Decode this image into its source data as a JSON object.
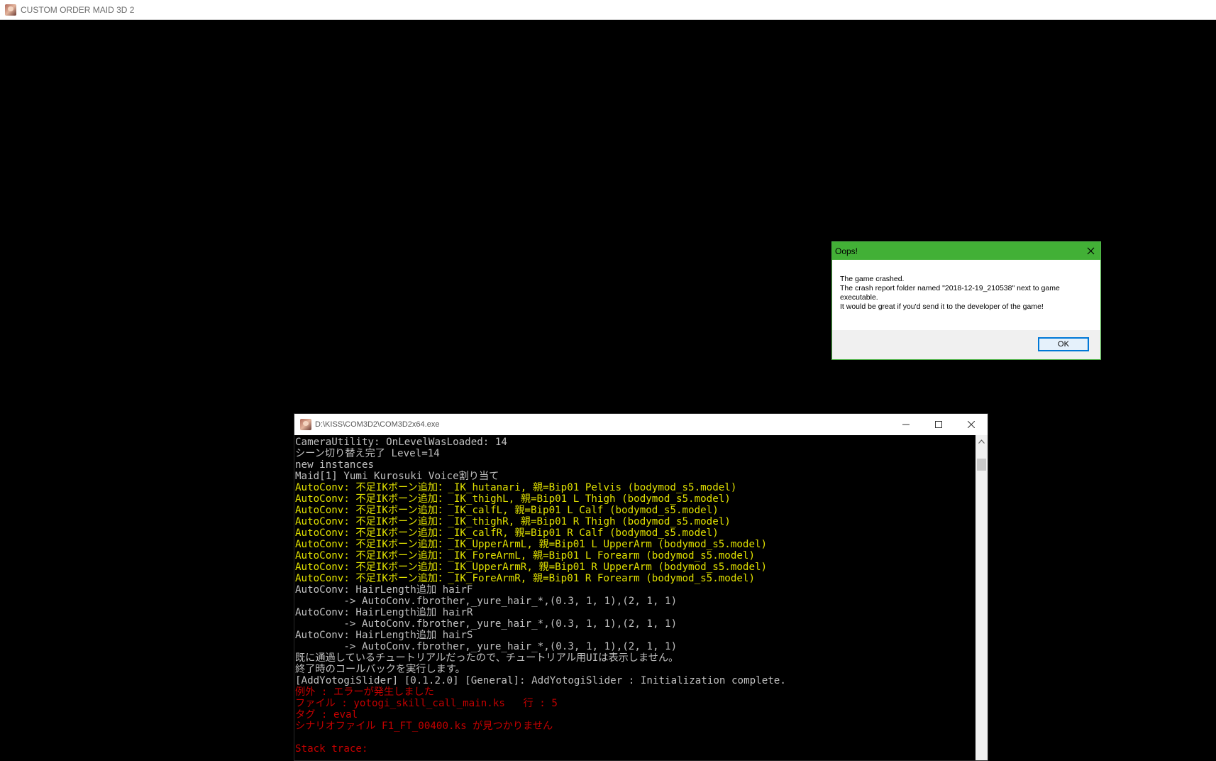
{
  "game_window": {
    "title": "CUSTOM ORDER MAID 3D 2"
  },
  "dialog": {
    "title": "Oops!",
    "lines": [
      "The game crashed.",
      "The crash report folder named \"2018-12-19_210538\" next to game executable.",
      "It would be great if you'd send it to the developer of the game!"
    ],
    "ok_label": "OK"
  },
  "console": {
    "title": "D:\\KISS\\COM3D2\\COM3D2x64.exe",
    "lines": [
      {
        "text": "CameraUtility: OnLevelWasLoaded: 14",
        "color": "white"
      },
      {
        "text": "シーン切り替え完了 Level=14",
        "color": "white"
      },
      {
        "text": "new instances",
        "color": "white"
      },
      {
        "text": "Maid[1] Yumi Kurosuki Voice割り当て",
        "color": "white"
      },
      {
        "text": "AutoConv: 不足IKボーン追加：_IK_hutanari, 親=Bip01 Pelvis (bodymod_s5.model)",
        "color": "yellow"
      },
      {
        "text": "AutoConv: 不足IKボーン追加：_IK_thighL, 親=Bip01 L Thigh (bodymod_s5.model)",
        "color": "yellow"
      },
      {
        "text": "AutoConv: 不足IKボーン追加：_IK_calfL, 親=Bip01 L Calf (bodymod_s5.model)",
        "color": "yellow"
      },
      {
        "text": "AutoConv: 不足IKボーン追加：_IK_thighR, 親=Bip01 R Thigh (bodymod_s5.model)",
        "color": "yellow"
      },
      {
        "text": "AutoConv: 不足IKボーン追加：_IK_calfR, 親=Bip01 R Calf (bodymod_s5.model)",
        "color": "yellow"
      },
      {
        "text": "AutoConv: 不足IKボーン追加：_IK_UpperArmL, 親=Bip01 L UpperArm (bodymod_s5.model)",
        "color": "yellow"
      },
      {
        "text": "AutoConv: 不足IKボーン追加：_IK_ForeArmL, 親=Bip01 L Forearm (bodymod_s5.model)",
        "color": "yellow"
      },
      {
        "text": "AutoConv: 不足IKボーン追加：_IK_UpperArmR, 親=Bip01 R UpperArm (bodymod_s5.model)",
        "color": "yellow"
      },
      {
        "text": "AutoConv: 不足IKボーン追加：_IK_ForeArmR, 親=Bip01 R Forearm (bodymod_s5.model)",
        "color": "yellow"
      },
      {
        "text": "AutoConv: HairLength追加 hairF",
        "color": "white"
      },
      {
        "text": "        -> AutoConv.fbrother,_yure_hair_*,(0.3, 1, 1),(2, 1, 1)",
        "color": "white"
      },
      {
        "text": "AutoConv: HairLength追加 hairR",
        "color": "white"
      },
      {
        "text": "        -> AutoConv.fbrother,_yure_hair_*,(0.3, 1, 1),(2, 1, 1)",
        "color": "white"
      },
      {
        "text": "AutoConv: HairLength追加 hairS",
        "color": "white"
      },
      {
        "text": "        -> AutoConv.fbrother,_yure_hair_*,(0.3, 1, 1),(2, 1, 1)",
        "color": "white"
      },
      {
        "text": "既に通過しているチュートリアルだったので、チュートリアル用UIは表示しません。",
        "color": "white"
      },
      {
        "text": "終了時のコールバックを実行します。",
        "color": "white"
      },
      {
        "text": "[AddYotogiSlider] [0.1.2.0] [General]: AddYotogiSlider : Initialization complete.",
        "color": "white"
      },
      {
        "text": "例外 : エラーが発生しました",
        "color": "red"
      },
      {
        "text": "ファイル : yotogi_skill_call_main.ks   行 : 5",
        "color": "red"
      },
      {
        "text": "タグ : eval",
        "color": "red"
      },
      {
        "text": "シナリオファイル F1_FT_00400.ks が見つかりません",
        "color": "red"
      },
      {
        "text": "",
        "color": "red"
      },
      {
        "text": "Stack trace:",
        "color": "red"
      }
    ]
  },
  "colors": {
    "dialog_title_bar": "#42b036",
    "console_white": "#c0c0c0",
    "console_yellow": "#e0e000",
    "console_red": "#c40000"
  }
}
